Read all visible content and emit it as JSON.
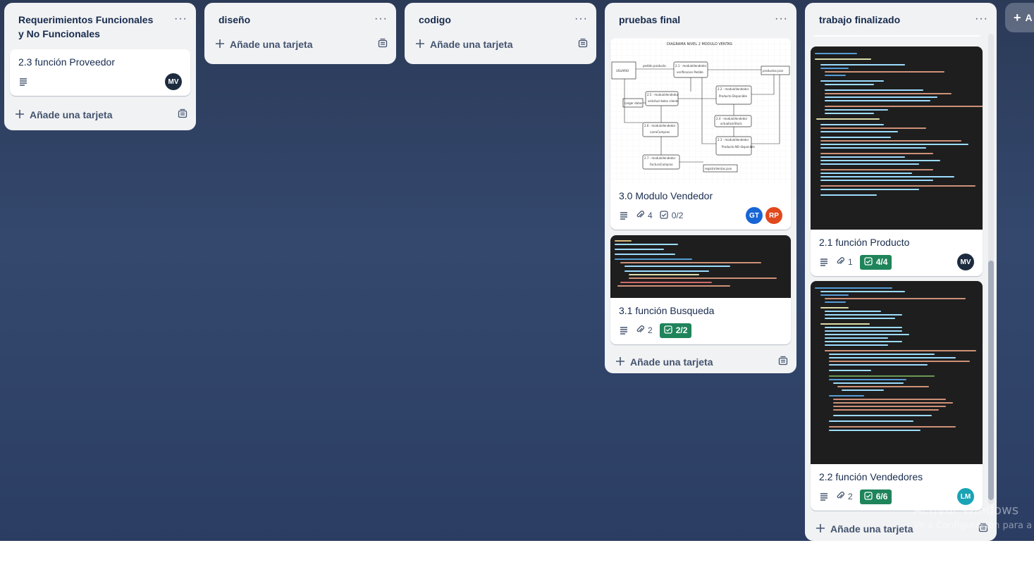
{
  "lists": [
    {
      "title": "Requerimientos Funcionales y No Funcionales",
      "menu": "···",
      "cards": [
        {
          "title": "2.3 función Proveedor",
          "avatar": "MV"
        }
      ],
      "add_card": "Añade una tarjeta"
    },
    {
      "title": "diseño",
      "menu": "···",
      "add_card": "Añade una tarjeta"
    },
    {
      "title": "codigo",
      "menu": "···",
      "add_card": "Añade una tarjeta"
    },
    {
      "title": "pruebas final",
      "menu": "···",
      "cards": [
        {
          "title": "3.0 Modulo Vendedor",
          "attachments": "4",
          "checklist": "0/2",
          "avatars": [
            "GT",
            "RP"
          ],
          "diagram": {
            "title": "DIAGRAMA NIVEL 2 MODULO VENTAS",
            "nodes": [
              "USUARIO",
              "2.1 - moduloVendedor",
              "verificacion Pedido",
              "productos.json",
              "2.5 - moduloVendedor",
              "solicitud datos cliente",
              "2.2 - moduloVendedor",
              "Producto Disponible",
              "cargar datos",
              "2.4 - moduloVendedor",
              "actualizarStock",
              "2.6 - moduloVendedor",
              "carroCompras",
              "2.3 - moduloVendedor",
              "Producto NO disponible",
              "2.7 - moduloVendedor",
              "FacturaCompras",
              "registroVentas.json"
            ],
            "edge_label": "pedido producto"
          }
        },
        {
          "title": "3.1 función Busqueda",
          "attachments": "2",
          "checklist": "2/2"
        }
      ],
      "add_card": "Añade una tarjeta"
    },
    {
      "title": "trabajo finalizado",
      "menu": "···",
      "cards": [
        {
          "title": "2.1 función Producto",
          "attachments": "1",
          "checklist": "4/4",
          "avatar": "MV"
        },
        {
          "title": "2.2 función Vendedores",
          "attachments": "2",
          "checklist": "6/6",
          "avatar": "LM"
        }
      ],
      "add_card": "Añade una tarjeta"
    }
  ],
  "add_list_label": "A",
  "watermark": {
    "line1": "Activar Windows",
    "line2": "Ve a Configuración para a"
  },
  "colors": {
    "avatar_MV": "#1d2b3f",
    "avatar_GT": "#1866d6",
    "avatar_RP": "#e0491d",
    "avatar_LM": "#1aa3b5",
    "checklist_done": "#1f845a"
  }
}
